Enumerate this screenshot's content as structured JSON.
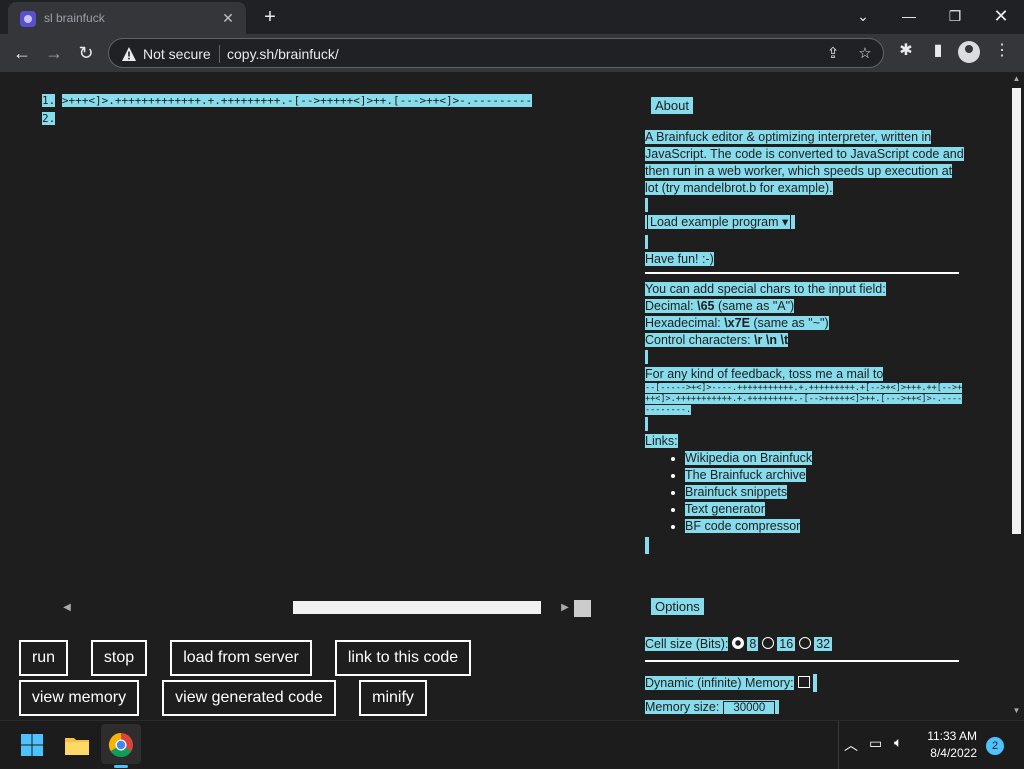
{
  "browser": {
    "tab_title": "sl brainfuck",
    "url": "copy.sh/brainfuck/",
    "security_label": "Not secure"
  },
  "editor": {
    "lines": [
      {
        "num": "1.",
        "code": ">+++<]>.+++++++++++++.+.+++++++++.-[-->+++++<]>++.[--->++<]>-.---------"
      },
      {
        "num": "2.",
        "code": ""
      }
    ]
  },
  "buttons": {
    "run": "run",
    "stop": "stop",
    "load_from_server": "load from server",
    "link_to_code": "link to this code",
    "view_memory": "view memory",
    "view_generated": "view generated code",
    "minify": "minify"
  },
  "about": {
    "heading": "About",
    "description": "A Brainfuck editor & optimizing interpreter, written in JavaScript. The code is converted to JavaScript code and then run in a web worker, which speeds up execution at lot (try mandelbrot.b for example).",
    "example_select": "Load example program",
    "have_fun": "Have fun! :-)",
    "special_intro": "You can add special chars to the input field:",
    "decimal_label": "Decimal: ",
    "decimal_code": "\\65",
    "decimal_note": " (same as \"A\")",
    "hex_label": "Hexadecimal: ",
    "hex_code": "\\x7E",
    "hex_note": " (same as \"~\")",
    "control_label": "Control characters: ",
    "control_code": "\\r \\n \\t",
    "feedback": "For any kind of feedback, toss me a mail to",
    "bf_mail": "--[----->+<]>----.+++++++++++.+.+++++++++.+[-->+<]>+++.++[-->+++<]>.+++++++++++.+.+++++++++.-[-->+++++<]>++.[--->++<]>-.------------.",
    "links_label": "Links:",
    "links": [
      "Wikipedia on Brainfuck",
      "The Brainfuck archive",
      "Brainfuck snippets",
      "Text generator",
      "BF code compressor"
    ]
  },
  "options": {
    "heading": "Options",
    "cell_size_label": "Cell size (Bits):",
    "cell_sizes": [
      "8",
      "16",
      "32"
    ],
    "selected_cell_size": "8",
    "dynamic_memory_label": "Dynamic (infinite) Memory:",
    "dynamic_memory_checked": false,
    "memory_size_label": "Memory size:",
    "memory_size": "30000"
  },
  "taskbar": {
    "time": "11:33 AM",
    "date": "8/4/2022",
    "notification_count": "2"
  }
}
